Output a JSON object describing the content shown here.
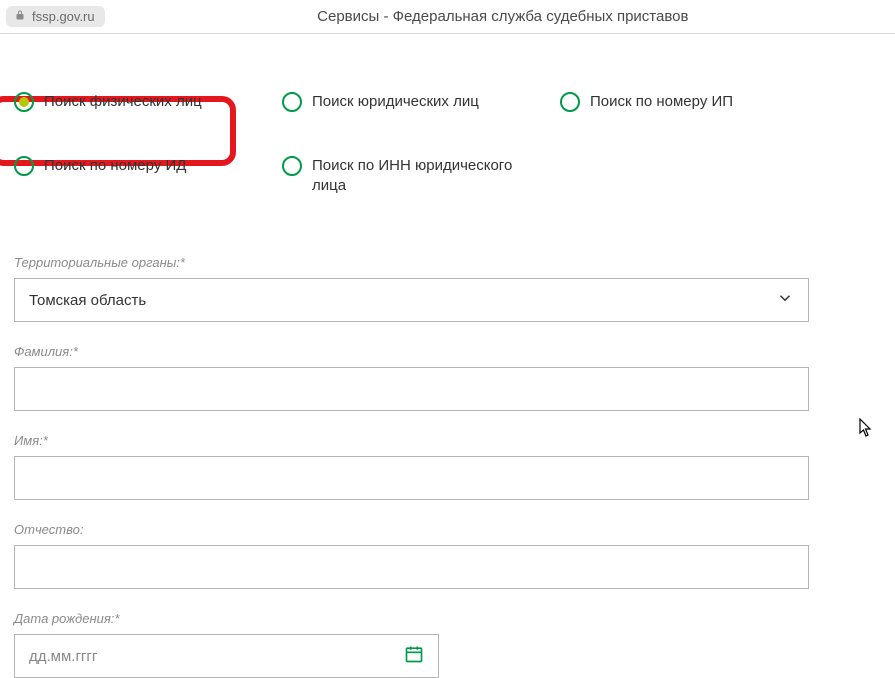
{
  "addressbar": {
    "url": "fssp.gov.ru",
    "title": "Сервисы - Федеральная служба судебных приставов"
  },
  "search_types": [
    {
      "label": "Поиск физических лиц",
      "selected": true
    },
    {
      "label": "Поиск юридических лиц",
      "selected": false
    },
    {
      "label": "Поиск по номеру ИП",
      "selected": false
    },
    {
      "label": "Поиск по номеру ИД",
      "selected": false
    },
    {
      "label": "Поиск по ИНН юридического лица",
      "selected": false
    }
  ],
  "fields": {
    "territory_label": "Территориальные органы:*",
    "territory_value": "Томская область",
    "lastname_label": "Фамилия:*",
    "lastname_value": "",
    "firstname_label": "Имя:*",
    "firstname_value": "",
    "patronymic_label": "Отчество:",
    "patronymic_value": "",
    "birthdate_label": "Дата рождения:*",
    "birthdate_placeholder": "дд.мм.гггг"
  }
}
